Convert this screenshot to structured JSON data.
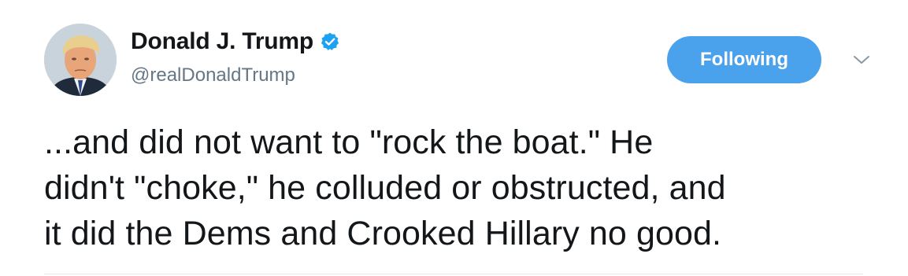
{
  "author": {
    "display_name": "Donald J. Trump",
    "handle": "@realDonaldTrump",
    "verified": true,
    "avatar_icon": "profile-photo-icon"
  },
  "actions": {
    "follow_label": "Following",
    "menu_icon": "chevron-down-icon"
  },
  "tweet": {
    "lines": [
      "...and did not want to \"rock the boat.\" He",
      "didn't \"choke,\" he colluded or obstructed, and",
      "it did the Dems and Crooked Hillary no good."
    ]
  },
  "colors": {
    "accent": "#4aa1ec",
    "text": "#14171a",
    "secondary_text": "#657786",
    "verified_badge": "#1da1f2"
  }
}
